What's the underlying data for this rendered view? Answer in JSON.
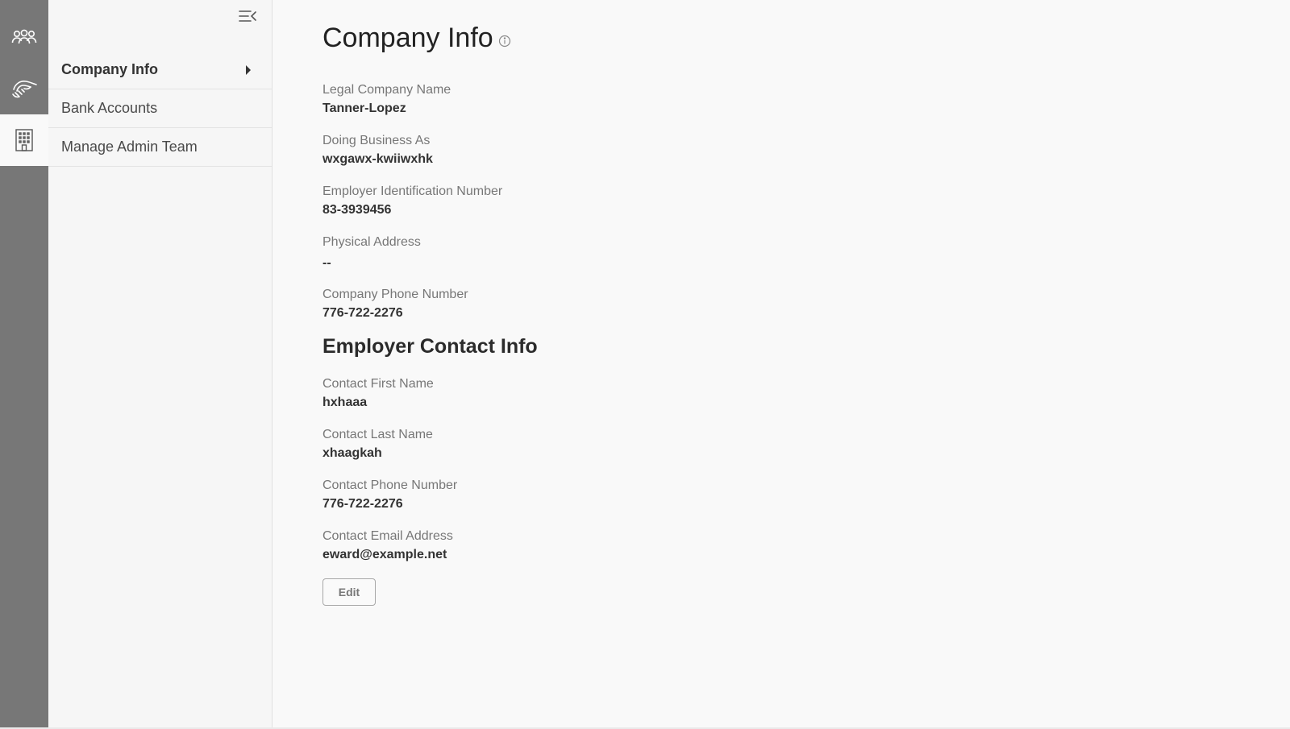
{
  "rail": {
    "items": [
      {
        "icon": "team-icon",
        "active": false
      },
      {
        "icon": "handshake-icon",
        "active": false
      },
      {
        "icon": "building-icon",
        "active": true
      }
    ]
  },
  "subnav": {
    "collapse_icon": "collapse-menu-icon",
    "items": [
      {
        "label": "Company Info",
        "active": true
      },
      {
        "label": "Bank Accounts",
        "active": false
      },
      {
        "label": "Manage Admin Team",
        "active": false
      }
    ]
  },
  "main": {
    "title": "Company Info",
    "company_fields": [
      {
        "label": "Legal Company Name",
        "value": "Tanner-Lopez"
      },
      {
        "label": "Doing Business As",
        "value": "wxgawx-kwiiwxhk"
      },
      {
        "label": "Employer Identification Number",
        "value": "83-3939456"
      },
      {
        "label": "Physical Address",
        "value": "--"
      },
      {
        "label": "Company Phone Number",
        "value": "776-722-2276"
      }
    ],
    "contact_heading": "Employer Contact Info",
    "contact_fields": [
      {
        "label": "Contact First Name",
        "value": "hxhaaa"
      },
      {
        "label": "Contact Last Name",
        "value": "xhaagkah"
      },
      {
        "label": "Contact Phone Number",
        "value": "776-722-2276"
      },
      {
        "label": "Contact Email Address",
        "value": "eward@example.net"
      }
    ],
    "edit_label": "Edit"
  },
  "colors": {
    "rail_bg": "#777777",
    "subnav_bg": "#f6f6f6",
    "page_bg": "#f9f9f9"
  }
}
